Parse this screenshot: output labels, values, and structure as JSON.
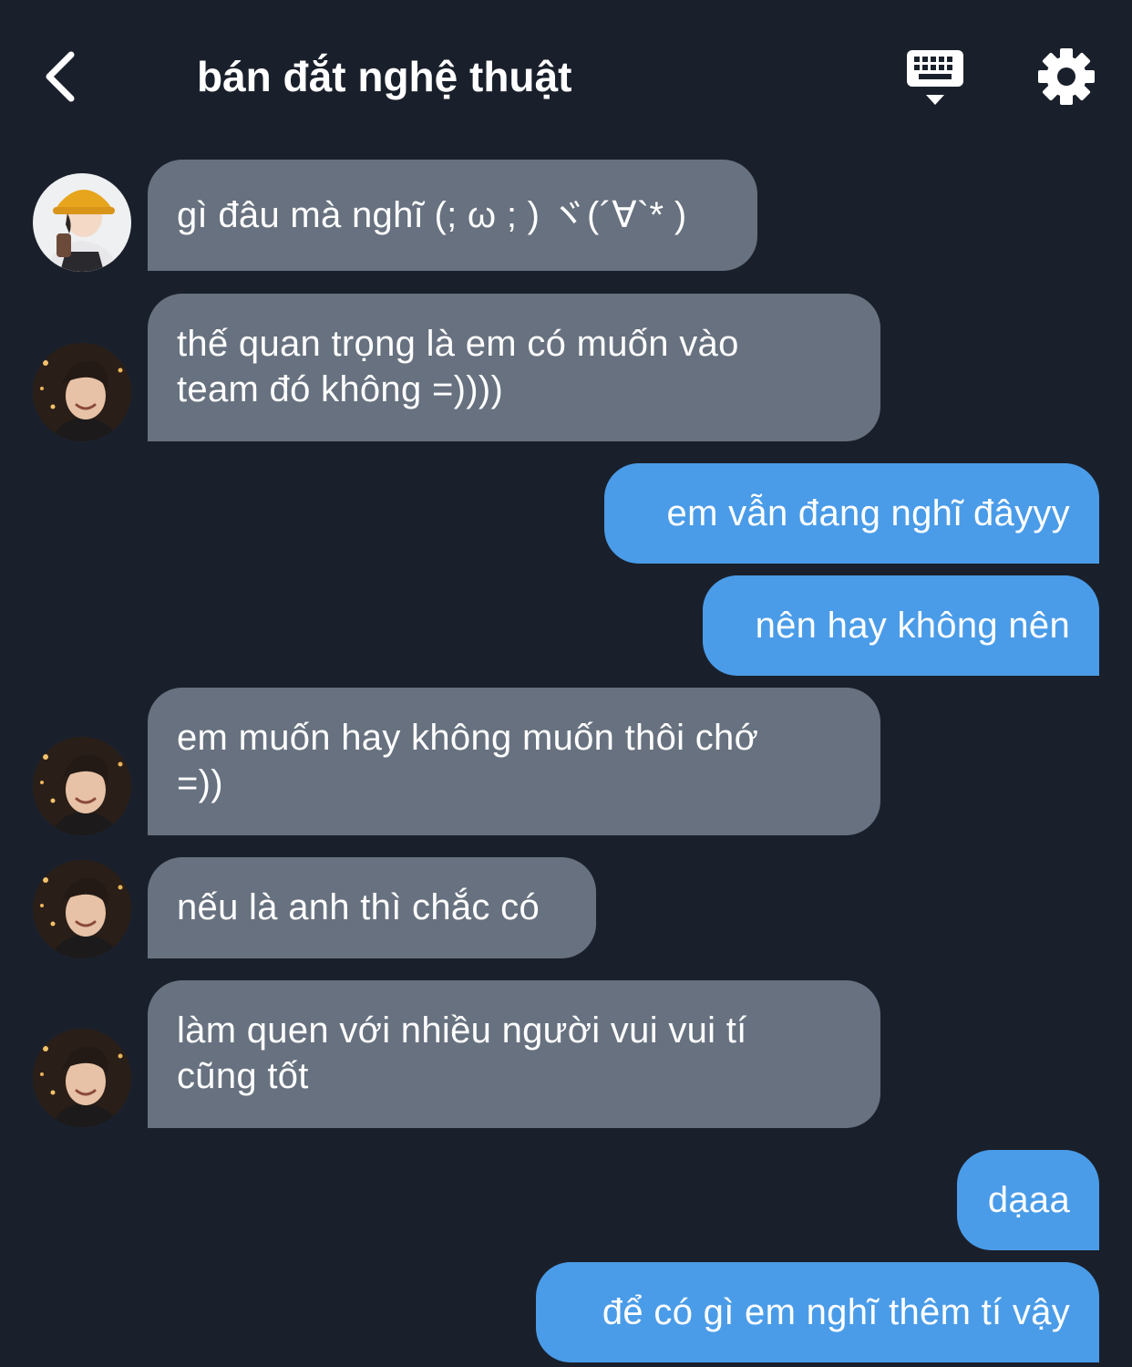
{
  "header": {
    "title": "bán đắt nghệ thuật",
    "back_icon": "chevron-left-icon",
    "keyboard_icon": "keyboard-icon",
    "settings_icon": "gear-icon"
  },
  "colors": {
    "background": "#1a202b",
    "incoming_bubble": "#67717f",
    "outgoing_bubble": "#4a9ce8",
    "text": "#ffffff"
  },
  "messages": [
    {
      "direction": "incoming",
      "avatar": "avatar-bucket-hat",
      "text": "gì đâu mà nghĩ (; ω ; ) ヾ(´∀`* )"
    },
    {
      "direction": "incoming",
      "avatar": "avatar-smiling",
      "text": "thế quan trọng là em có muốn vào\nteam đó không =))))"
    },
    {
      "direction": "outgoing",
      "text": "em vẫn đang nghĩ đâyyy"
    },
    {
      "direction": "outgoing",
      "text": "nên hay không nên"
    },
    {
      "direction": "incoming",
      "avatar": "avatar-smiling",
      "text": "em muốn hay không muốn thôi chớ\n=))"
    },
    {
      "direction": "incoming",
      "avatar": "avatar-smiling",
      "text": "nếu là anh thì chắc có"
    },
    {
      "direction": "incoming",
      "avatar": "avatar-smiling",
      "text": "làm quen với nhiều người vui vui tí\ncũng tốt"
    },
    {
      "direction": "outgoing",
      "text": "dạaa"
    },
    {
      "direction": "outgoing",
      "text": "để có gì em nghĩ thêm tí vậy"
    }
  ]
}
